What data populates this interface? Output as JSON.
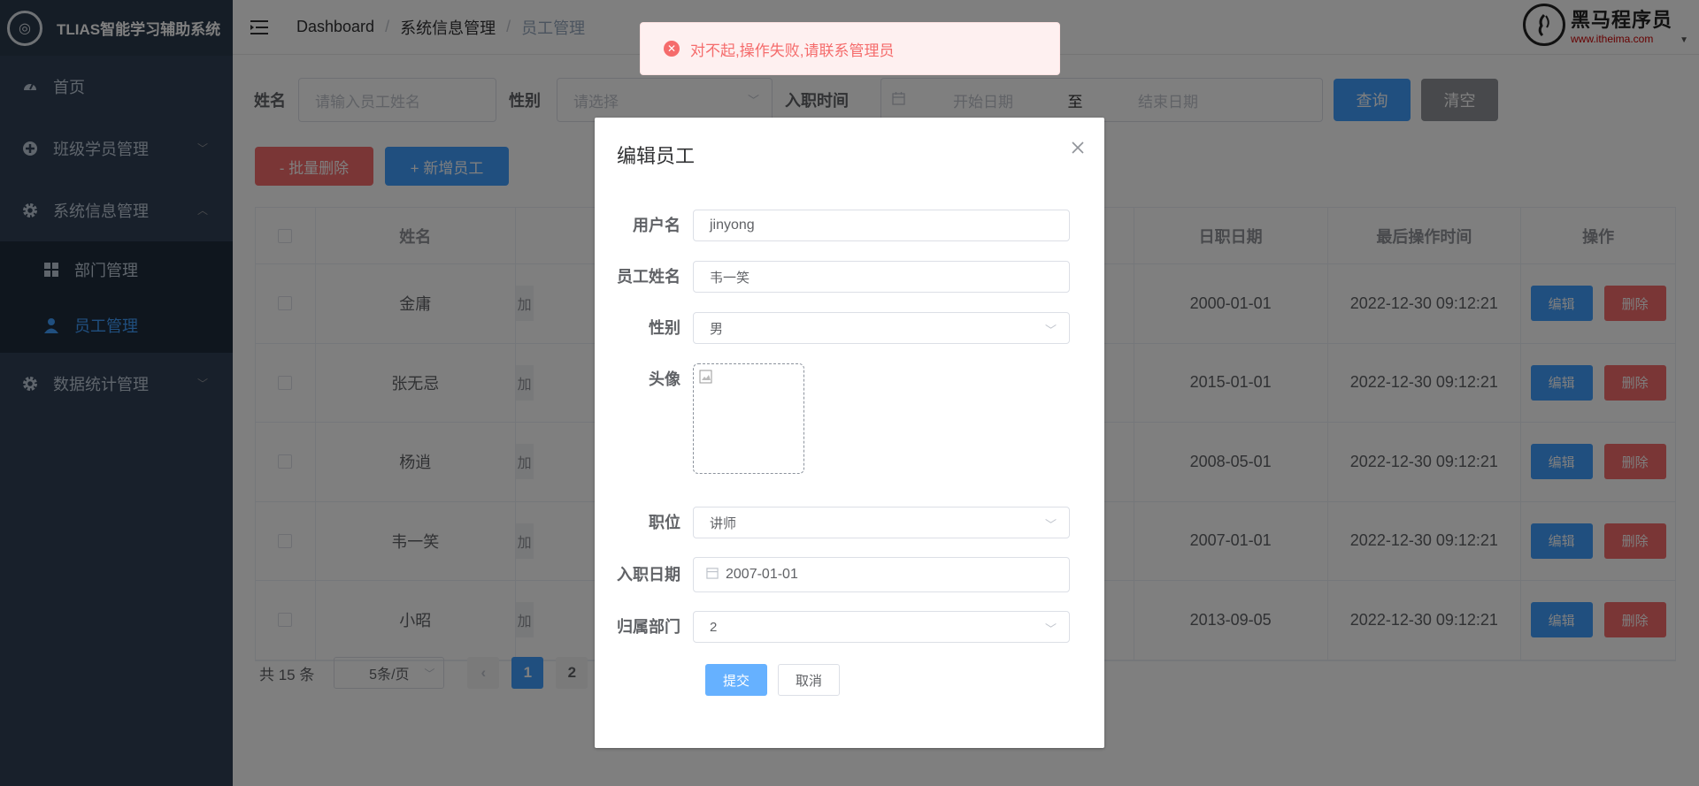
{
  "app": {
    "logo_glyph": "◎",
    "title": "TLIAS智能学习辅助系统"
  },
  "sidebar": {
    "items": [
      {
        "label": "首页",
        "icon": "dashboard-icon"
      },
      {
        "label": "班级学员管理",
        "icon": "plus-circle-icon"
      },
      {
        "label": "系统信息管理",
        "icon": "gear-icon",
        "expanded": true
      },
      {
        "label": "数据统计管理",
        "icon": "gear-icon"
      }
    ],
    "sub_items": [
      {
        "label": "部门管理",
        "icon": "grid-icon"
      },
      {
        "label": "员工管理",
        "icon": "user-icon",
        "active": true
      }
    ]
  },
  "header": {
    "breadcrumb": [
      "Dashboard",
      "系统信息管理",
      "员工管理"
    ],
    "brand_name": "黑马程序员",
    "brand_url": "www.itheima.com"
  },
  "search": {
    "name_label": "姓名",
    "name_placeholder": "请输入员工姓名",
    "gender_label": "性别",
    "gender_placeholder": "请选择",
    "date_label": "入职时间",
    "start_placeholder": "开始日期",
    "to_text": "至",
    "end_placeholder": "结束日期",
    "query_label": "查询",
    "clear_label": "清空"
  },
  "actions": {
    "batch_delete": "- 批量删除",
    "add_employee": "+ 新增员工"
  },
  "table": {
    "headers": {
      "name": "姓名",
      "entry_date": "日职日期",
      "update_time": "最后操作时间",
      "ops": "操作"
    },
    "position_cell_glyph": "加",
    "rows": [
      {
        "name": "金庸",
        "entry_date": "2000-01-01",
        "update_time": "2022-12-30 09:12:21"
      },
      {
        "name": "张无忌",
        "entry_date": "2015-01-01",
        "update_time": "2022-12-30 09:12:21"
      },
      {
        "name": "杨逍",
        "entry_date": "2008-05-01",
        "update_time": "2022-12-30 09:12:21"
      },
      {
        "name": "韦一笑",
        "entry_date": "2007-01-01",
        "update_time": "2022-12-30 09:12:21"
      },
      {
        "name": "小昭",
        "entry_date": "2013-09-05",
        "update_time": "2022-12-30 09:12:21"
      }
    ],
    "edit_label": "编辑",
    "delete_label": "删除"
  },
  "pager": {
    "total": "共 15 条",
    "page_size": "5条/页",
    "pages": [
      "1",
      "2"
    ],
    "current": "1"
  },
  "dialog": {
    "title": "编辑员工",
    "fields": {
      "username_label": "用户名",
      "username_value": "jinyong",
      "name_label": "员工姓名",
      "name_value": "韦一笑",
      "gender_label": "性别",
      "gender_value": "男",
      "avatar_label": "头像",
      "job_label": "职位",
      "job_value": "讲师",
      "entry_label": "入职日期",
      "entry_value": "2007-01-01",
      "dept_label": "归属部门",
      "dept_value": "2"
    },
    "submit_label": "提交",
    "cancel_label": "取消"
  },
  "toast": {
    "message": "对不起,操作失败,请联系管理员"
  },
  "colors": {
    "primary": "#409eff",
    "danger": "#f56c6c",
    "sidebar_bg": "#304156"
  }
}
